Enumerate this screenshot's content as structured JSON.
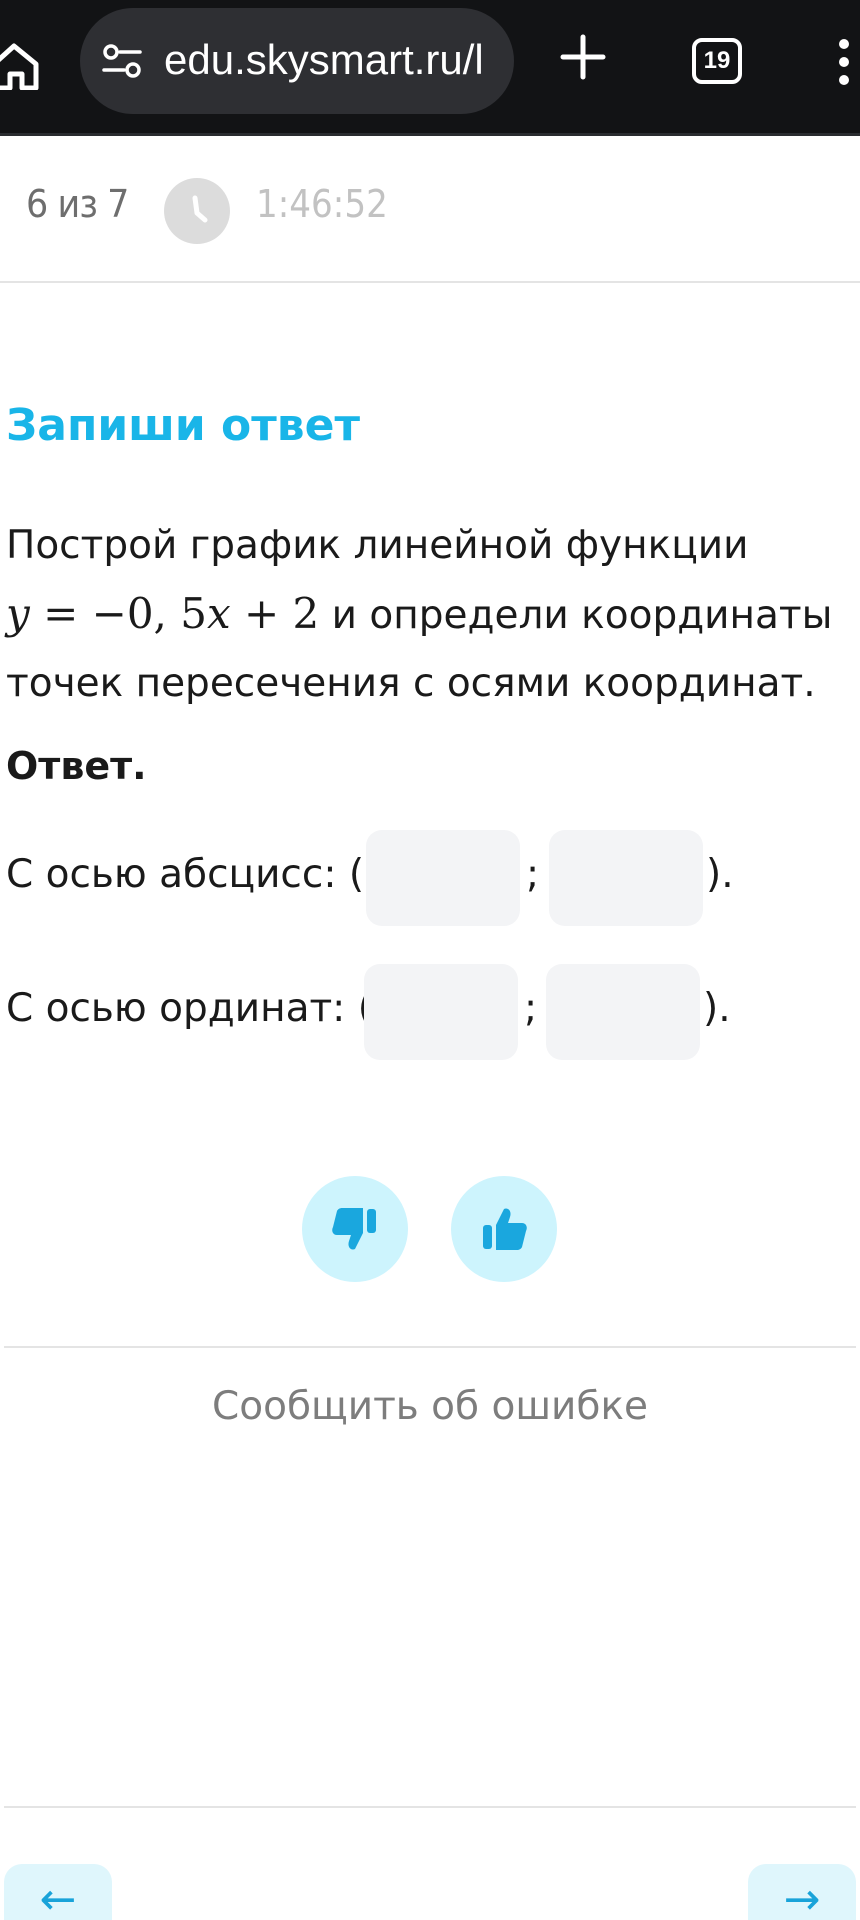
{
  "browser": {
    "url": "edu.skysmart.ru/l",
    "tab_count": "19"
  },
  "header": {
    "progress": "6 из 7",
    "timer": "1:46:52"
  },
  "task": {
    "title": "Запиши ответ",
    "text_before": "Построй график линейной функции",
    "formula": {
      "y": "y",
      "eq": " = −0, 5",
      "x": "x",
      "tail": " + 2"
    },
    "text_after": " и определи координаты точек пересечения с осями координат."
  },
  "answer": {
    "label": "Ответ.",
    "rows": [
      {
        "label": "С осью абсцисс: (",
        "separator": ";",
        "closing": ").",
        "values": [
          "",
          ""
        ]
      },
      {
        "label": "С осью ординат: (",
        "separator": ";",
        "closing": ").",
        "values": [
          "",
          ""
        ]
      }
    ]
  },
  "feedback": {
    "report_label": "Сообщить об ошибке"
  },
  "navigation": {
    "prev_arrow": "←",
    "next_arrow": "→"
  },
  "colors": {
    "accent": "#19b5e8",
    "vote_bg": "#cdf4fd",
    "vote_icon": "#1aa7de",
    "field_bg": "#f3f4f6"
  }
}
